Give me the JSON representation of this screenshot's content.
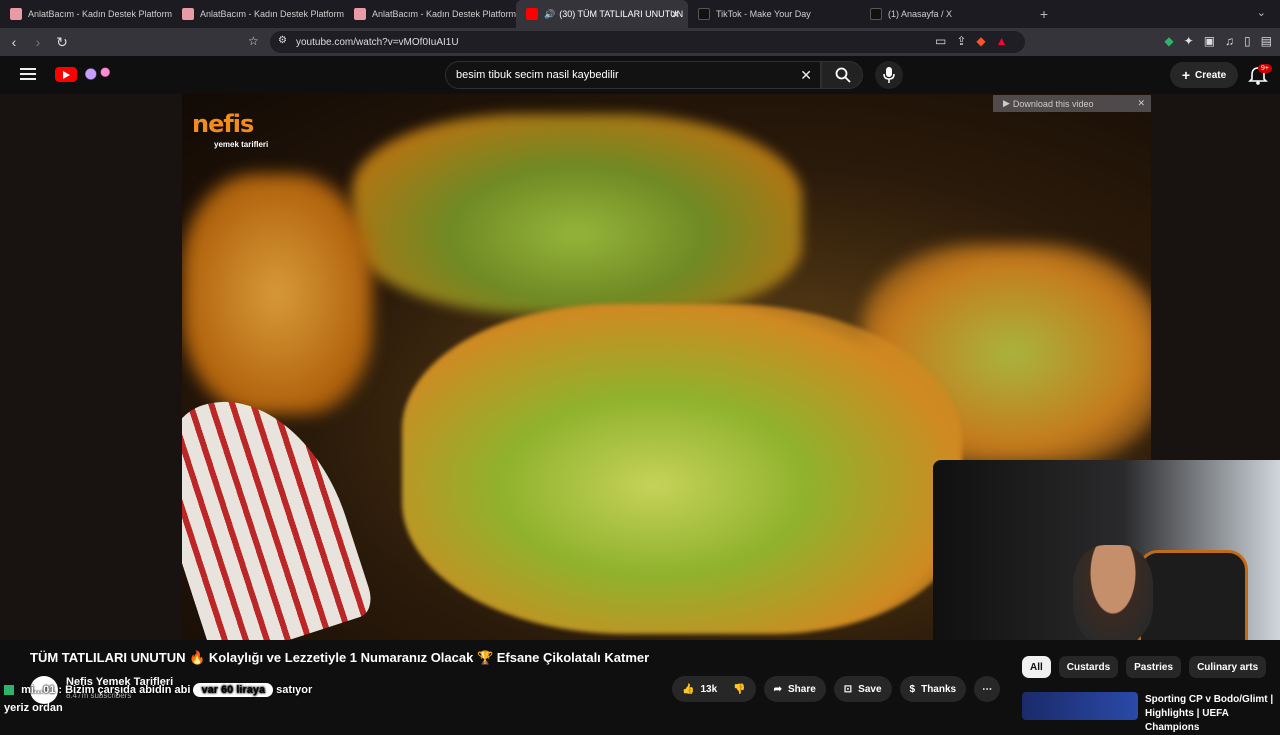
{
  "browser": {
    "tabs": [
      {
        "title": "AnlatBacım - Kadın Destek Platformu",
        "favicon_color": "#e89aa5"
      },
      {
        "title": "AnlatBacım - Kadın Destek Platformu",
        "favicon_color": "#e89aa5"
      },
      {
        "title": "AnlatBacım - Kadın Destek Platformu",
        "favicon_color": "#e89aa5"
      },
      {
        "title": "(30) TÜM TATLILARI UNUTUN",
        "favicon_color": "#ff0000",
        "active": true
      },
      {
        "title": "TikTok - Make Your Day",
        "favicon_color": "#111111"
      },
      {
        "title": "(1) Anasayfa / X",
        "favicon_color": "#111111"
      }
    ],
    "url": "youtube.com/watch?v=vMOf0IuAI1U"
  },
  "youtube": {
    "search_query": "besim tibuk secim nasil kaybedilir",
    "create_label": "Create",
    "notifications_badge": "9+",
    "video": {
      "watermark_brand": "nefis",
      "watermark_sub": "yemek tarifleri",
      "download_overlay": "Download this video",
      "title": "TÜM TATLILARI UNUTUN 🔥 Kolaylığı ve Lezzetiyle 1 Numaranız Olacak 🏆 Efsane Çikolatalı Katmer",
      "channel": "Nefis Yemek Tarifleri",
      "subscribers": "8.47m subscribers",
      "likes": "13k",
      "share_label": "Share",
      "save_label": "Save",
      "thanks_label": "Thanks"
    },
    "chat": {
      "user": "mi...01",
      "message_pre": ": Bizim çarşıda abidin abi",
      "message_pill": "var 60 liraya",
      "message_post": "satıyor",
      "message_line2": "yeriz ordan"
    },
    "chips": [
      "All",
      "Custards",
      "Pastries",
      "Culinary arts"
    ],
    "recommended": {
      "title": "Sporting CP v Bodo/Glimt | Highlights | UEFA Champions"
    }
  }
}
